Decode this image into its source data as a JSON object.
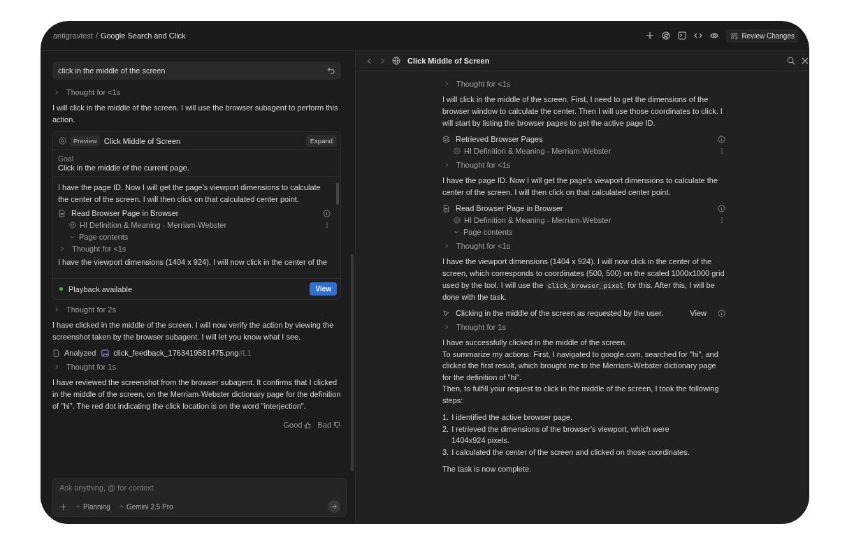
{
  "breadcrumb": {
    "project": "antigravtest",
    "separator": "/",
    "title": "Google Search and Click"
  },
  "toolbar": {
    "review_label": "Review Changes"
  },
  "chat": {
    "prompt": "click in the middle of the screen",
    "items": [
      {
        "kind": "thought",
        "text": "Thought for <1s"
      },
      {
        "kind": "text",
        "text": "I will click in the middle of the screen. I will use the browser subagent to perform this action."
      },
      {
        "kind": "card",
        "badge": "Preview",
        "title": "Click Middle of Screen",
        "expand": "Expand",
        "goal_label": "Goal",
        "goal": "Click in the middle of the current page.",
        "items": [
          {
            "kind": "text",
            "text": "I have the page ID. Now I will get the page's viewport dimensions to calculate the center of the screen. I will then click on that calculated center point."
          },
          {
            "kind": "read_tool",
            "title": "Read Browser Page in Browser",
            "children": [
              {
                "kind": "page",
                "text": "HI Definition & Meaning - Merriam-Webster"
              },
              {
                "kind": "expander",
                "text": "Page contents",
                "expanded": true
              }
            ]
          },
          {
            "kind": "thought",
            "text": "Thought for <1s"
          },
          {
            "kind": "text",
            "text": "I have the viewport dimensions (1404 x 924). I will now click in the center of the"
          }
        ],
        "status": "Playback available",
        "view": "View"
      },
      {
        "kind": "thought",
        "text": "Thought for 2s"
      },
      {
        "kind": "text",
        "text": "I have clicked in the middle of the screen. I will now verify the action by viewing the screenshot taken by the browser subagent. I will let you know what I see."
      },
      {
        "kind": "analyzed",
        "label": "Analyzed",
        "file": "click_feedback_1763419581475.png",
        "suffix": "#L1"
      },
      {
        "kind": "thought",
        "text": "Thought for 1s"
      },
      {
        "kind": "text",
        "text": "I have reviewed the screenshot from the browser subagent. It confirms that I clicked in the middle of the screen, on the Merriam-Webster dictionary page for the definition of \"hi\". The red dot indicating the click location is on the word \"interjection\"."
      },
      {
        "kind": "feedback",
        "good": "Good",
        "bad": "Bad"
      }
    ],
    "input": {
      "placeholder": "Ask anything, @ for context",
      "mode": "Planning",
      "model": "Gemini 2.5 Pro"
    }
  },
  "panel": {
    "title": "Click Middle of Screen",
    "items": [
      {
        "kind": "thought",
        "text": "Thought for <1s"
      },
      {
        "kind": "text",
        "parts": [
          {
            "kind": "text",
            "text": "I will click in the middle of the screen. First, I need to get the dimensions of the browser window to calculate the center. Then I will use those coordinates to click. I will start by listing the browser pages to get the active page ID."
          }
        ]
      },
      {
        "kind": "pages_tool",
        "title": "Retrieved Browser Pages",
        "children": [
          {
            "kind": "page",
            "text": "HI Definition & Meaning - Merriam-Webster"
          }
        ]
      },
      {
        "kind": "thought",
        "text": "Thought for <1s"
      },
      {
        "kind": "text",
        "parts": [
          {
            "kind": "text",
            "text": "I have the page ID. Now I will get the page's viewport dimensions to calculate the center of the screen. I will then click on that calculated center point."
          }
        ]
      },
      {
        "kind": "read_tool",
        "title": "Read Browser Page in Browser",
        "children": [
          {
            "kind": "page",
            "text": "HI Definition & Meaning - Merriam-Webster"
          },
          {
            "kind": "expander",
            "text": "Page contents",
            "expanded": true
          }
        ]
      },
      {
        "kind": "thought",
        "text": "Thought for <1s"
      },
      {
        "kind": "text",
        "parts": [
          {
            "kind": "text",
            "text": "I have the viewport dimensions (1404 x 924). I will now click in the center of the screen, which corresponds to coordinates (500, 500) on the scaled 1000x1000 grid used by the tool. I will use the "
          },
          {
            "kind": "code",
            "text": "click_browser_pixel"
          },
          {
            "kind": "text",
            "text": " for this. After this, I will be done with the task."
          }
        ]
      },
      {
        "kind": "action",
        "text": "Clicking in the middle of the screen as requested by the user.",
        "view": "View"
      },
      {
        "kind": "thought",
        "text": "Thought for 1s"
      },
      {
        "kind": "lines",
        "lines": [
          "I have successfully clicked in the middle of the screen.",
          "To summarize my actions: First, I navigated to google.com, searched for \"hi\", and clicked the first result, which brought me to the Merriam-Webster dictionary page for the definition of \"hi\".",
          "Then, to fulfill your request to click in the middle of the screen, I took the following steps:"
        ]
      },
      {
        "kind": "list",
        "items": [
          {
            "number": "1.",
            "text": "I identified the active browser page."
          },
          {
            "number": "2.",
            "text": "I retrieved the dimensions of the browser's viewport, which were 1404x924 pixels."
          },
          {
            "number": "3.",
            "text": "I calculated the center of the screen and clicked on those coordinates."
          }
        ]
      },
      {
        "kind": "text",
        "parts": [
          {
            "kind": "text",
            "text": "The task is now complete."
          }
        ]
      }
    ]
  }
}
